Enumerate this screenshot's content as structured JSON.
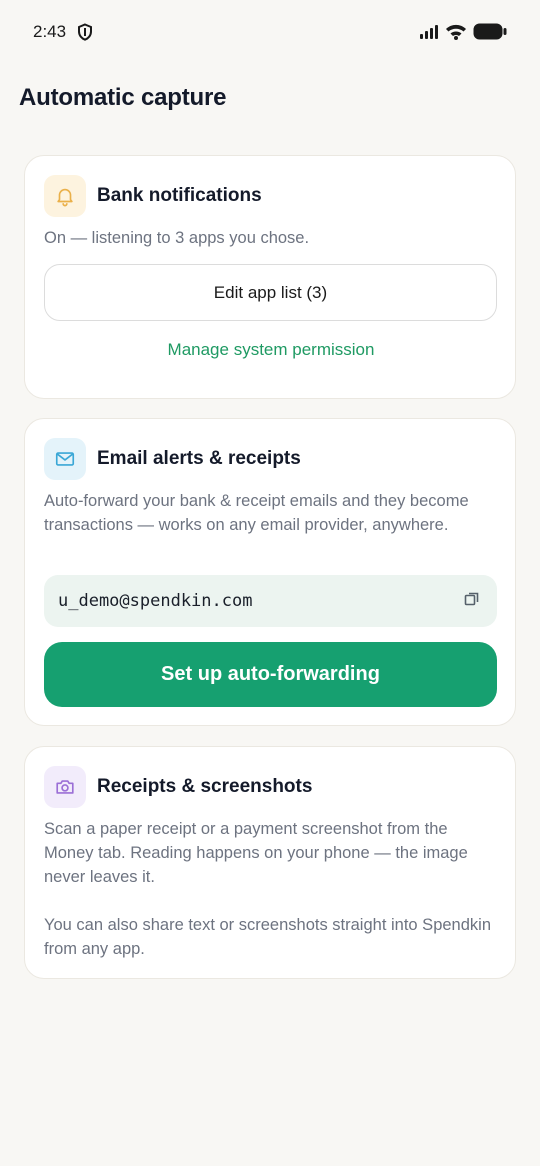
{
  "status_bar": {
    "time": "2:43"
  },
  "page": {
    "title": "Automatic capture"
  },
  "bank_card": {
    "title": "Bank notifications",
    "description": "On — listening to 3 apps you chose.",
    "edit_button": "Edit app list (3)",
    "permission_link": "Manage system permission",
    "icon": "bell-icon"
  },
  "email_card": {
    "title": "Email alerts & receipts",
    "description": "Auto-forward your bank & receipt emails and they become transactions — works on any email provider, anywhere.",
    "address": "u_demo@spendkin.com",
    "setup_button": "Set up auto-forwarding",
    "icon": "mail-icon"
  },
  "receipts_card": {
    "title": "Receipts & screenshots",
    "description": "Scan a paper receipt or a payment screenshot from the Money tab. Reading happens on your phone — the image never leaves it.",
    "description2": "You can also share text or screenshots straight into Spendkin from any app.",
    "icon": "camera-icon"
  },
  "colors": {
    "accent": "#16a070",
    "link": "#1f9a63",
    "background": "#f8f7f4"
  }
}
